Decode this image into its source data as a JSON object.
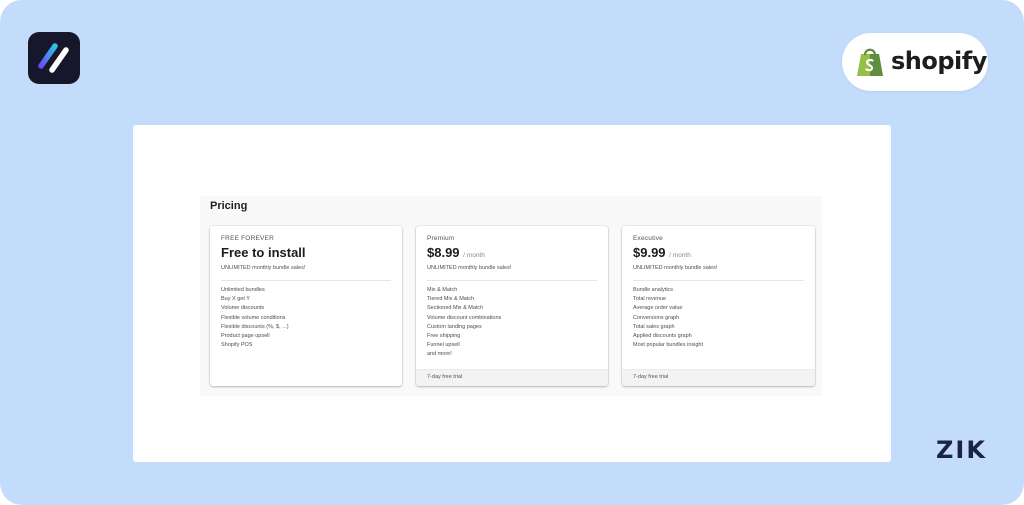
{
  "colors": {
    "background": "#c4dcfb",
    "app_logo_bg": "#17172b",
    "shopify_green": "#95bf47",
    "brand_text": "#1d2343"
  },
  "icons": {
    "app_logo": "diagonal-stripes-logo-icon",
    "shopify_logo": "shopify-bag-icon"
  },
  "branding": {
    "shopify_wordmark": "shopify",
    "corner_mark": "ZIK"
  },
  "pricing": {
    "title": "Pricing",
    "plans": [
      {
        "name": "FREE FOREVER",
        "price": "Free to install",
        "period": "",
        "tagline": "UNLIMITED monthly bundle sales!",
        "features": [
          "Unlimited bundles",
          "Buy X get Y",
          "Volume discounts",
          "Flexible volume conditions",
          "Flexible discounts (%, $, ...)",
          "Product page upsell",
          "Shopify POS"
        ],
        "footer": ""
      },
      {
        "name": "Premium",
        "price": "$8.99",
        "period": "/ month",
        "tagline": "UNLIMITED monthly bundle sales!",
        "features": [
          "Mix & Match",
          "Tiered Mix & Match",
          "Sectioned Mix & Match",
          "Volume discount combinations",
          "Custom landing pages",
          "Free shipping",
          "Funnel upsell",
          "and more!"
        ],
        "footer": "7-day free trial"
      },
      {
        "name": "Executive",
        "price": "$9.99",
        "period": "/ month",
        "tagline": "UNLIMITED monthly bundle sales!",
        "features": [
          "Bundle analytics",
          "Total revenue",
          "Average order value",
          "Conversions graph",
          "Total sales graph",
          "Applied discounts graph",
          "Most popular bundles insight"
        ],
        "footer": "7-day free trial"
      }
    ]
  }
}
